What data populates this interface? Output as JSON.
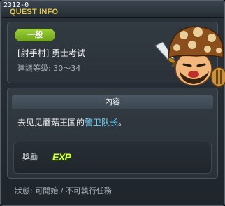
{
  "window": {
    "quest_id": "2312-0",
    "title": "QUEST INFO"
  },
  "quest": {
    "category": "一般",
    "name": "[射手村] 勇士考试",
    "level_range": "建議等级: 30～34",
    "monster_icon": "mushroom-warrior-icon"
  },
  "content": {
    "header": "內容",
    "description_prefix": "去见见蘑菇王国的",
    "description_npc": "警卫队长",
    "description_suffix": "。"
  },
  "reward": {
    "label": "獎勵",
    "exp_label": "EXP"
  },
  "status": {
    "text": "狀態: 可開始 / 不可執行任務"
  },
  "colors": {
    "title": "#e7c84a",
    "category_badge": "#8cc22a",
    "npc_highlight": "#6fd5ff",
    "exp": "#d6ff3a"
  }
}
